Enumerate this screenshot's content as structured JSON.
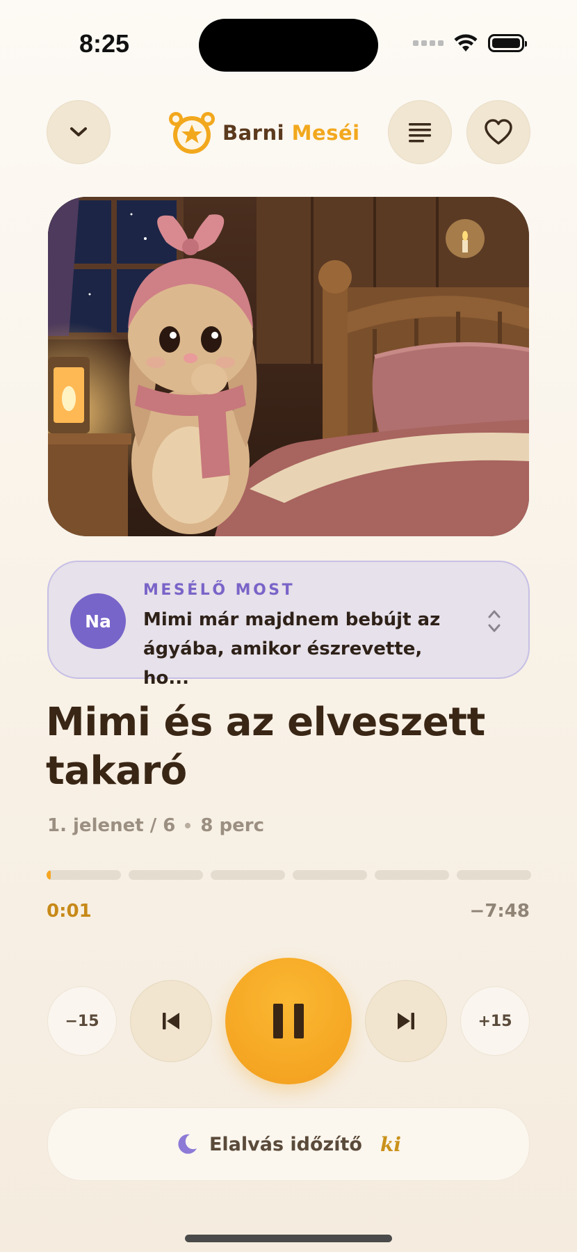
{
  "status_bar": {
    "time": "8:25"
  },
  "header": {
    "logo_text_1": "Barni",
    "logo_text_2": "Meséi"
  },
  "narrator": {
    "avatar_initials": "Na",
    "label": "MESÉLŐ MOST",
    "text": "Mimi már majdnem bebújt az ágyába, amikor észrevette, ho..."
  },
  "story": {
    "title": "Mimi és az elveszett takaró",
    "scene": "1. jelenet / 6",
    "duration": "8 perc"
  },
  "progress": {
    "segments": 6,
    "current_segment": 1,
    "segment_fraction": 0.06,
    "elapsed": "0:01",
    "remaining": "−7:48"
  },
  "controls": {
    "rewind_label": "−15",
    "forward_label": "+15"
  },
  "sleep_timer": {
    "label": "Elalvás időzítő",
    "value": "ki"
  },
  "colors": {
    "accent": "#f5a623",
    "narrator_purple": "#7865c9",
    "title_brown": "#3a2615"
  }
}
